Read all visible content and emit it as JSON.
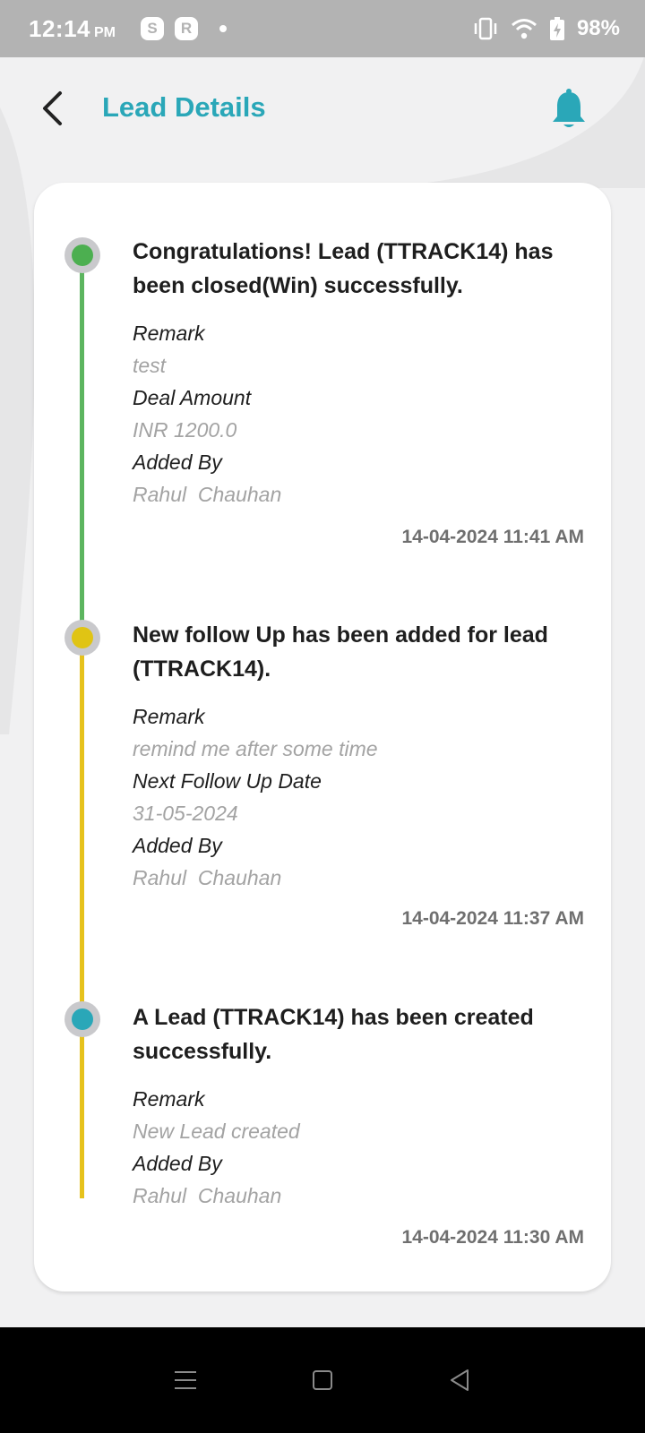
{
  "status_bar": {
    "time": "12:14",
    "ampm": "PM",
    "app_icons": [
      "S",
      "R"
    ],
    "battery": "98%"
  },
  "header": {
    "title": "Lead Details",
    "back_icon": "back-arrow-icon",
    "notification_icon": "bell-icon",
    "accent_color": "#2aa7b8"
  },
  "timeline": [
    {
      "title": "Congratulations! Lead (TTRACK14) has been closed(Win) successfully.",
      "dot_color": "#4caf50",
      "fields": [
        {
          "label": "Remark",
          "value": "test"
        },
        {
          "label": "Deal Amount",
          "value": "INR 1200.0"
        },
        {
          "label": "Added By",
          "value": "Rahul  Chauhan"
        }
      ],
      "timestamp": "14-04-2024 11:41 AM"
    },
    {
      "title": "New follow Up has been added for lead (TTRACK14).",
      "dot_color": "#e0c414",
      "fields": [
        {
          "label": "Remark",
          "value": "remind me after some time"
        },
        {
          "label": "Next Follow Up Date",
          "value": "31-05-2024"
        },
        {
          "label": "Added By",
          "value": "Rahul  Chauhan"
        }
      ],
      "timestamp": "14-04-2024 11:37 AM"
    },
    {
      "title": "A Lead (TTRACK14) has been created successfully.",
      "dot_color": "#2aa7b8",
      "fields": [
        {
          "label": "Remark",
          "value": "New Lead created"
        },
        {
          "label": "Added By",
          "value": "Rahul  Chauhan"
        }
      ],
      "timestamp": "14-04-2024 11:30 AM"
    }
  ],
  "nav_bar": {
    "icons": [
      "menu-icon",
      "home-square-icon",
      "back-triangle-icon"
    ]
  }
}
